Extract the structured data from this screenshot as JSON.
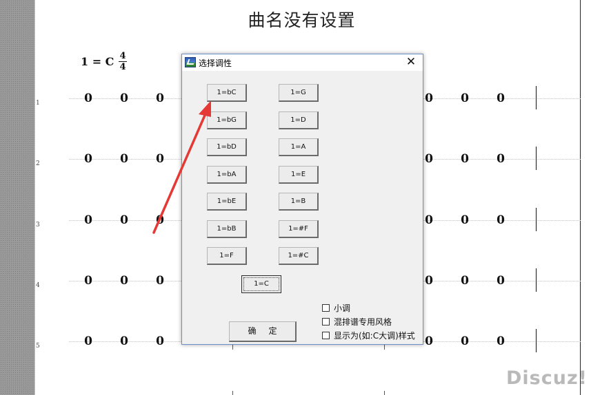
{
  "score": {
    "title": "曲名没有设置",
    "key_signature": "1 = C",
    "time_signature": {
      "top": "4",
      "bottom": "4"
    },
    "row_numbers": [
      "1",
      "2",
      "3",
      "4",
      "5"
    ],
    "note_value": "0"
  },
  "dialog": {
    "title": "选择调性",
    "close_glyph": "✕",
    "left_keys": [
      "1=bC",
      "1=bG",
      "1=bD",
      "1=bA",
      "1=bE",
      "1=bB",
      "1=F"
    ],
    "right_keys": [
      "1=G",
      "1=D",
      "1=A",
      "1=E",
      "1=B",
      "1=#F",
      "1=#C"
    ],
    "center_key": "1=C",
    "selected_key": "1=C",
    "ok_label": "确定",
    "options": [
      {
        "label": "小调",
        "checked": false
      },
      {
        "label": "混排谱专用风格",
        "checked": false
      },
      {
        "label": "显示为(如:C大调)样式",
        "checked": false
      }
    ]
  },
  "annotation": {
    "arrow_color": "#e53935"
  },
  "watermark": "Discuz!",
  "icons": [
    "app-icon",
    "close-icon"
  ]
}
